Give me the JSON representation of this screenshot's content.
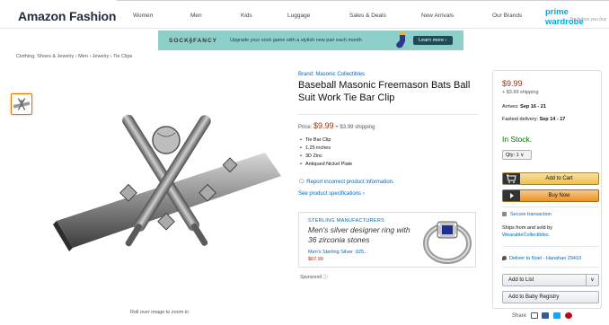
{
  "header": {
    "brand": "Amazon Fashion",
    "nav": [
      "Women",
      "Men",
      "Kids",
      "Luggage",
      "Sales & Deals",
      "New Arrivals",
      "Our Brands"
    ],
    "prime_label": "prime wardrobe",
    "prime_tagline": "Try before you buy"
  },
  "banner": {
    "logo": "SOCK⟠FANCY",
    "text": "Upgrade your sock game with a stylish new pair each month",
    "button": "Learn more ›"
  },
  "breadcrumb": "Clothing, Shoes & Jewelry › Men › Jewelry › Tie Clips",
  "gallery": {
    "zoom_hint": "Roll over image to zoom in"
  },
  "product": {
    "brand_link": "Brand: Masonic Collectibles",
    "title": "Baseball Masonic Freemason Bats Ball Suit Work Tie Bar Clip",
    "price_label": "Price:",
    "price": "$9.99",
    "shipping": "+ $3.99 shipping",
    "bullets": [
      "Tie Bar Clip",
      "1.25 inches",
      "3D Zinc",
      "Antiqued Nickel Plate"
    ],
    "report_link": "Report incorrect product information.",
    "specs_link": "See product specifications ›"
  },
  "ad": {
    "header": "STERLING MANUFACTURERS",
    "headline": "Men's silver designer ring with 36 zirconia stones",
    "sub": "Men's Sterling Silver .925...",
    "price": "$67.99",
    "sponsored": "Sponsored"
  },
  "buybox": {
    "price": "$9.99",
    "shipping": "+ $3.99 shipping",
    "arrives_label": "Arrives:",
    "arrives": "Sep 16 - 21",
    "fastest_label": "Fastest delivery:",
    "fastest": "Sep 14 - 17",
    "stock": "In Stock.",
    "qty": "Qty: 1",
    "add_to_cart": "Add to Cart",
    "buy_now": "Buy Now",
    "secure": "Secure transaction",
    "ships_from": "Ships from and sold by",
    "seller": "WearableCollectibles.",
    "deliver": "Deliver to Noel - Hanahan 29410",
    "add_to_list": "Add to List",
    "add_to_registry": "Add to Baby Registry"
  },
  "share": {
    "label": "Share"
  },
  "colors": {
    "price": "#b12704",
    "stock": "#007600",
    "link": "#0066c0",
    "cart_button": "#f0c14b",
    "buy_button": "#ed9220",
    "banner": "#8fcfc9"
  }
}
